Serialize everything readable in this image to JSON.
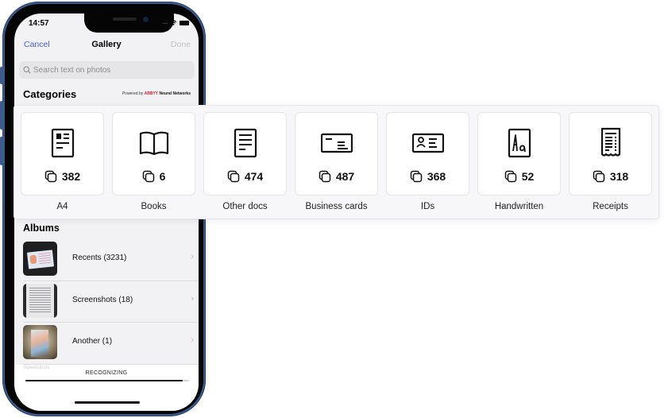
{
  "status_bar": {
    "time": "14:57",
    "signal": "....",
    "wifi": "wifi-icon",
    "battery": "battery-icon"
  },
  "nav": {
    "cancel_label": "Cancel",
    "title": "Gallery",
    "done_label": "Done"
  },
  "search": {
    "placeholder": "Search text on photos",
    "icon": "search-icon"
  },
  "categories_section": {
    "title": "Categories",
    "powered_prefix": "Powered by",
    "powered_brand": "ABBYY",
    "powered_suffix": "Neural Networks"
  },
  "categories": [
    {
      "label": "A4",
      "count": "382",
      "icon": "a4-document-icon"
    },
    {
      "label": "Books",
      "count": "6",
      "icon": "book-icon"
    },
    {
      "label": "Other docs",
      "count": "474",
      "icon": "document-lines-icon"
    },
    {
      "label": "Business cards",
      "count": "487",
      "icon": "business-card-icon"
    },
    {
      "label": "IDs",
      "count": "368",
      "icon": "id-card-icon"
    },
    {
      "label": "Handwritten",
      "count": "52",
      "icon": "handwritten-icon"
    },
    {
      "label": "Receipts",
      "count": "318",
      "icon": "receipt-icon"
    }
  ],
  "albums_section": {
    "title": "Albums",
    "items": [
      {
        "label": "Recents (3231)"
      },
      {
        "label": "Screenshots (18)"
      },
      {
        "label": "Another (1)"
      }
    ],
    "partial_next": "Screenshots"
  },
  "recognizing": {
    "label": "RECOGNIZING",
    "progress_fraction": 0.96
  },
  "colors": {
    "accent": "#4a5fd6",
    "brand_red": "#d8232a",
    "frame": "#3d5a8a"
  }
}
